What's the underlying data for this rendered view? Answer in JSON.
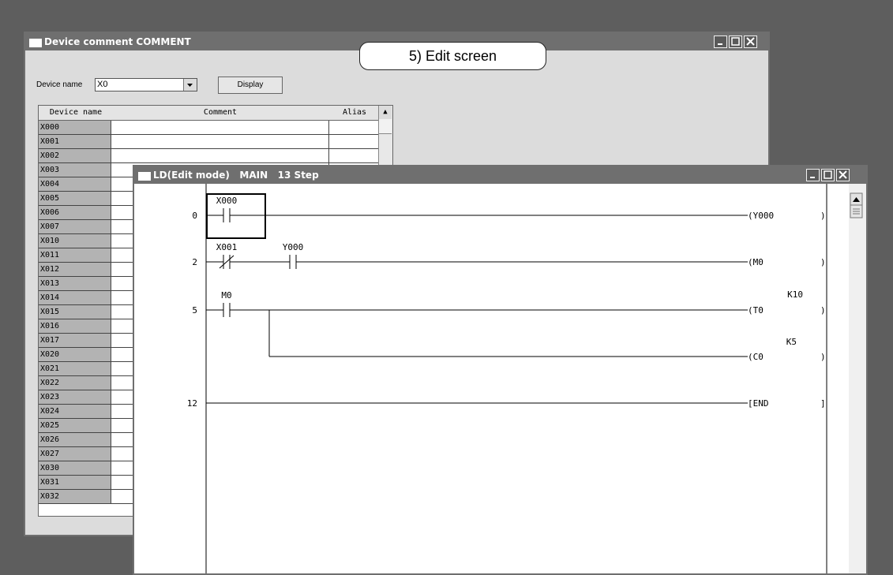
{
  "comment_window": {
    "title": "Device comment COMMENT",
    "device_name_label": "Device name",
    "device_name_value": "X0",
    "display_button": "Display",
    "columns": [
      "Device name",
      "Comment",
      "Alias"
    ],
    "rows": [
      "X000",
      "X001",
      "X002",
      "X003",
      "X004",
      "X005",
      "X006",
      "X007",
      "X010",
      "X011",
      "X012",
      "X013",
      "X014",
      "X015",
      "X016",
      "X017",
      "X020",
      "X021",
      "X022",
      "X023",
      "X024",
      "X025",
      "X026",
      "X027",
      "X030",
      "X031",
      "X032"
    ]
  },
  "callout": {
    "text": "5) Edit screen"
  },
  "ladder_window": {
    "title": "LD(Edit mode)   MAIN   13 Step",
    "steps": [
      "0",
      "2",
      "5",
      "12"
    ],
    "contacts": {
      "x000": "X000",
      "x001": "X001",
      "y000": "Y000",
      "m0": "M0"
    },
    "coils": {
      "y000": "(Y000",
      "m0": "(M0",
      "t0": "(T0",
      "c0": "(C0",
      "end": "[END"
    },
    "coil_closers": [
      ")",
      ")",
      ")",
      ")",
      "]"
    ],
    "constants": {
      "t0": "K10",
      "c0": "K5"
    }
  },
  "colors": {
    "desktop": "#5e5e5e",
    "titlebar": "#6f6f6f",
    "device_cell": "#b3b3b3"
  }
}
